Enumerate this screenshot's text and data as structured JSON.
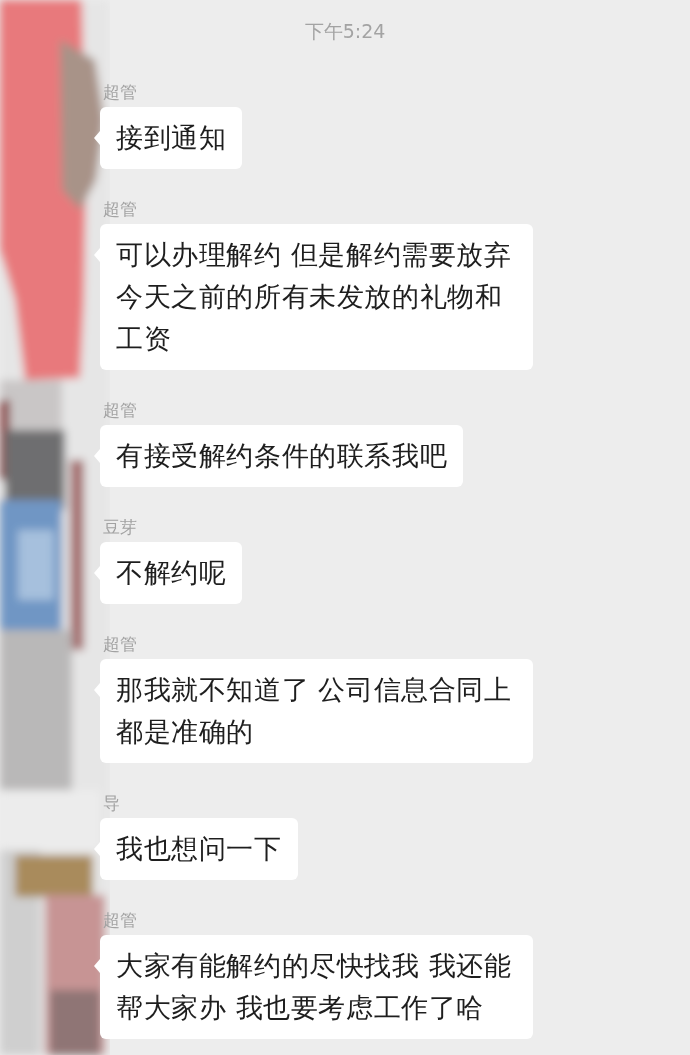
{
  "timestamp": "下午5:24",
  "messages": [
    {
      "sender": "超管",
      "text": "接到通知"
    },
    {
      "sender": "超管",
      "text": "可以办理解约 但是解约需要放弃今天之前的所有未发放的礼物和工资"
    },
    {
      "sender": "超管",
      "text": "有接受解约条件的联系我吧"
    },
    {
      "sender": "豆芽",
      "text": "不解约呢"
    },
    {
      "sender": "超管",
      "text": "那我就不知道了 公司信息合同上都是准确的"
    },
    {
      "sender": "导",
      "text": "我也想问一下"
    },
    {
      "sender": "超管",
      "text": "大家有能解约的尽快找我 我还能帮大家办 我也要考虑工作了哈"
    }
  ]
}
